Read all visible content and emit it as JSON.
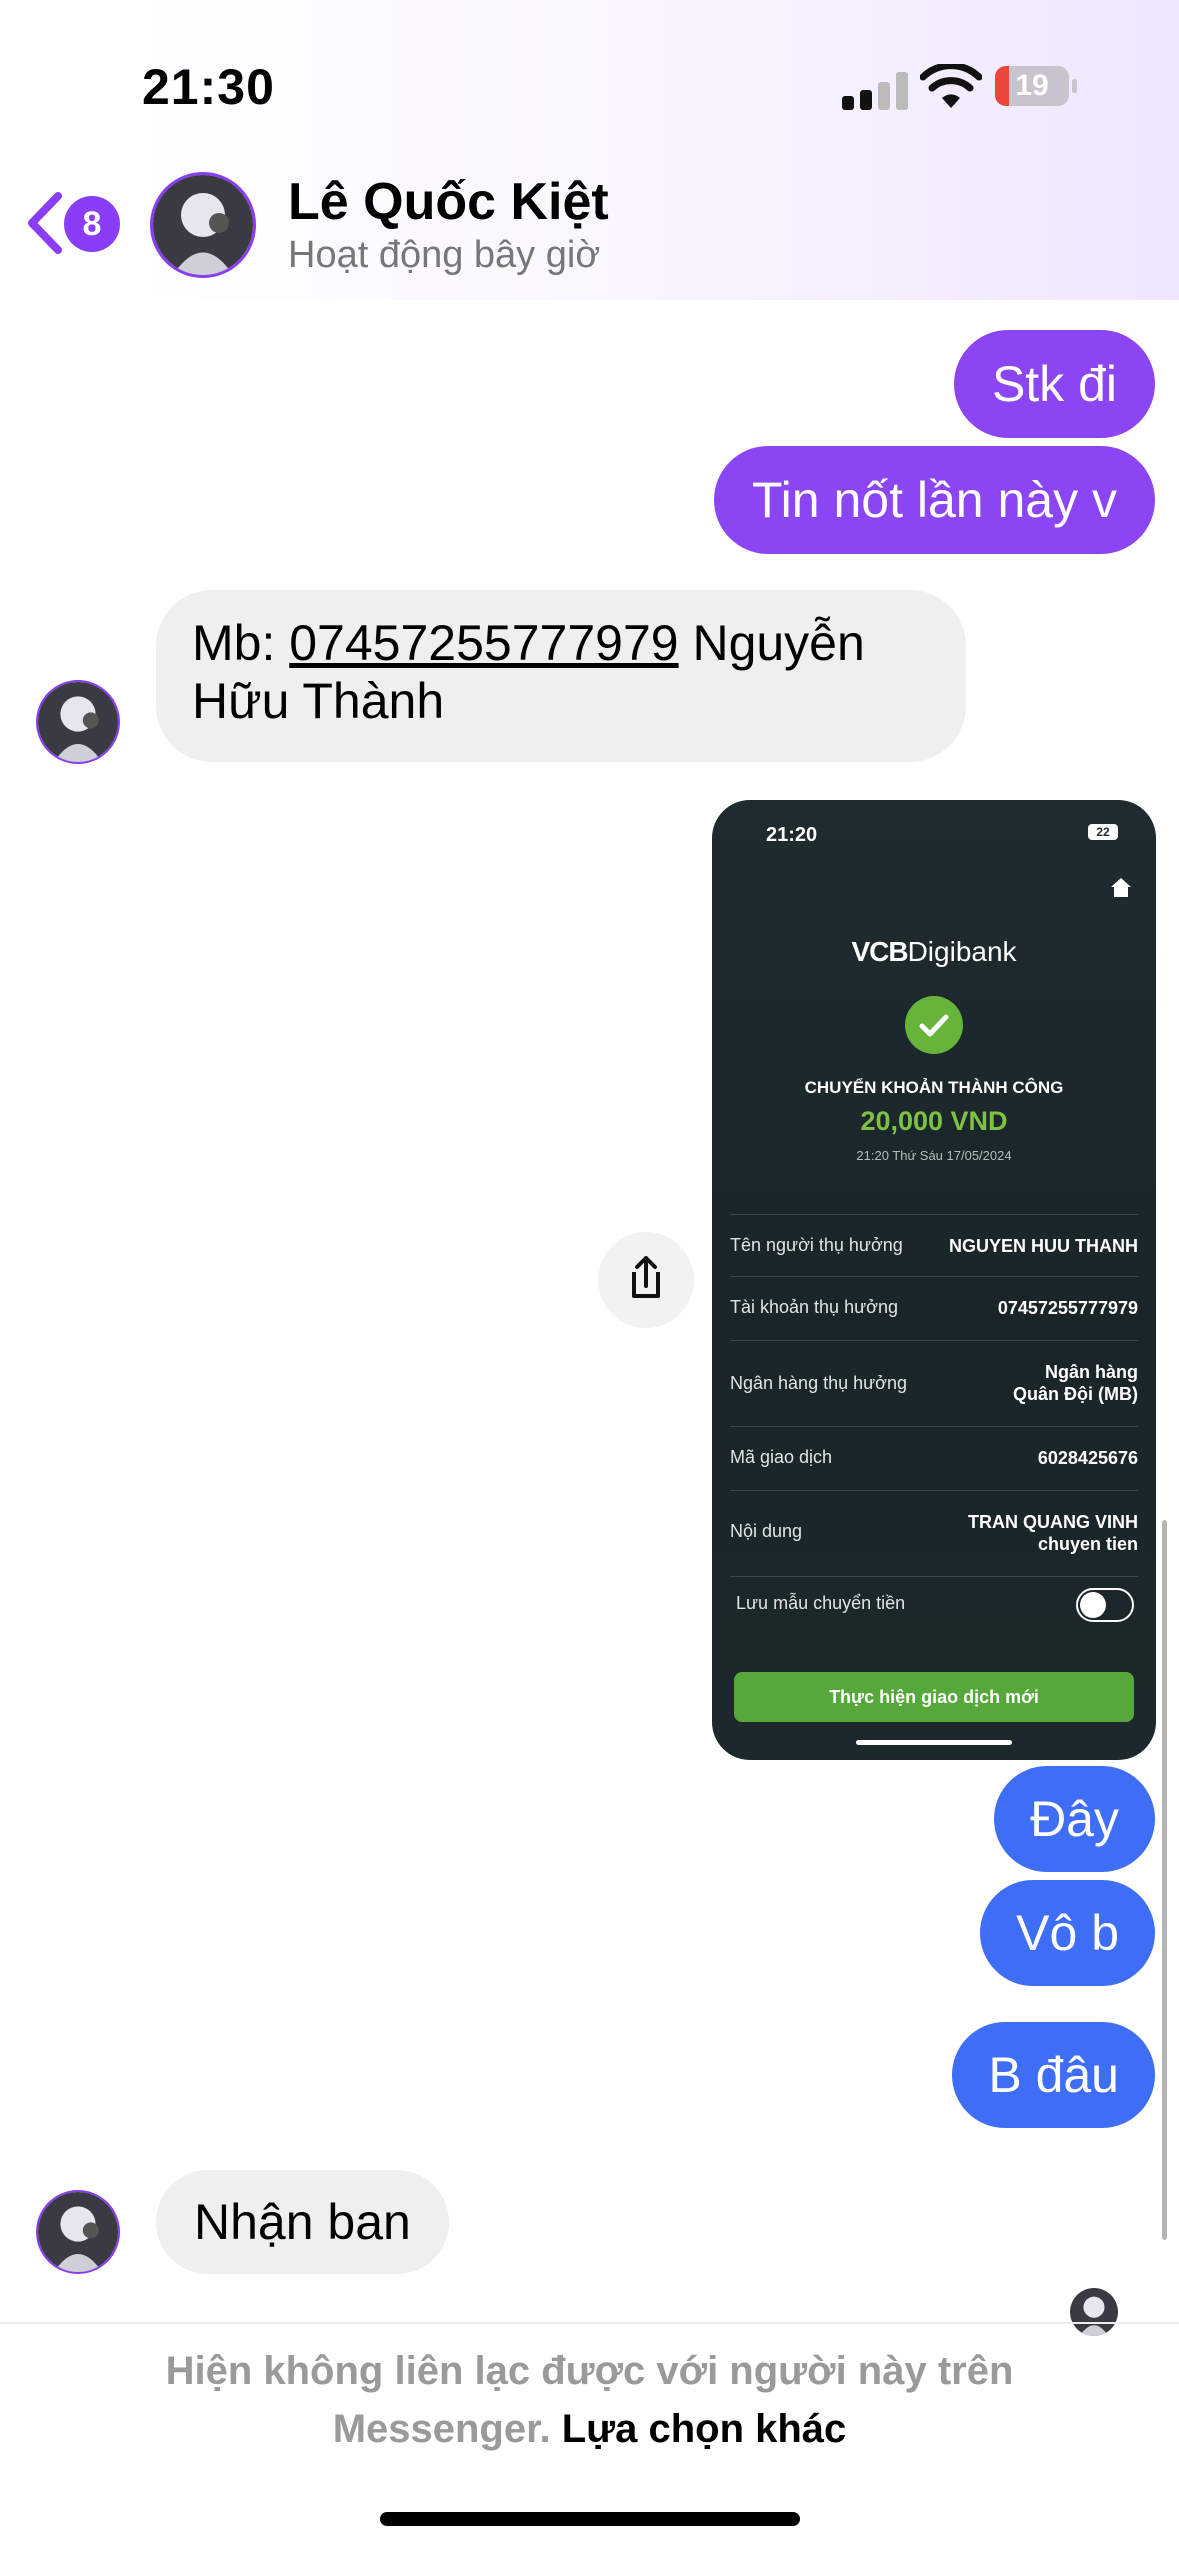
{
  "status_bar": {
    "time": "21:30",
    "battery": "19"
  },
  "header": {
    "unread_count": "8",
    "contact_name": "Lê Quốc Kiệt",
    "contact_status": "Hoạt động bây giờ"
  },
  "messages": {
    "m1": "Stk đi",
    "m2": "Tin nốt lần này v",
    "m3_prefix": "Mb: ",
    "m3_number": "07457255777979",
    "m3_suffix": " Nguyễn",
    "m3_line2": "Hữu Thành",
    "m5": "Đây",
    "m6": "Vô b",
    "m7": "B đâu",
    "m8": "Nhận ban"
  },
  "receipt": {
    "time": "21:20",
    "battery": "22",
    "brand_bold": "VCB",
    "brand_rest": "Digibank",
    "success": "CHUYỂN KHOẢN THÀNH CÔNG",
    "amount": "20,000 VND",
    "date": "21:20 Thứ Sáu 17/05/2024",
    "rows": [
      {
        "label": "Tên người thụ hưởng",
        "value": "NGUYEN HUU THANH"
      },
      {
        "label": "Tài khoản thụ hưởng",
        "value": "07457255777979"
      },
      {
        "label": "Ngân hàng thụ hưởng",
        "value": "Ngân hàng Quân Đội (MB)"
      },
      {
        "label": "Mã giao dịch",
        "value": "6028425676"
      },
      {
        "label": "Nội dung",
        "value": "TRAN QUANG VINH chuyen tien"
      }
    ],
    "save_template": "Lưu mẫu chuyển tiền",
    "save_template_on": false,
    "new_transaction": "Thực hiện giao dịch mới"
  },
  "footer": {
    "notice": "Hiện không liên lạc được với người này trên Messenger.",
    "option": "Lựa chọn khác"
  },
  "colors": {
    "accent_purple": "#8b45f2",
    "accent_blue": "#3f6ef6",
    "incoming_bubble": "#efefef",
    "vcb_green": "#7dc242"
  }
}
